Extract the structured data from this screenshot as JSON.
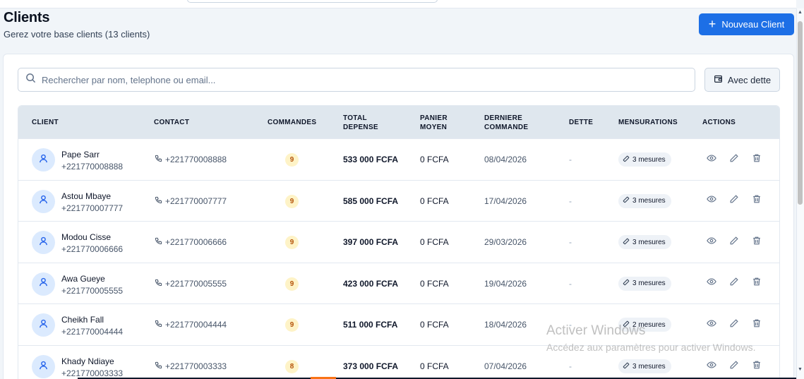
{
  "header": {
    "title": "Clients",
    "subtitle": "Gerez votre base clients (13 clients)",
    "new_client_label": "Nouveau Client"
  },
  "search": {
    "placeholder": "Rechercher par nom, telephone ou email..."
  },
  "filter": {
    "debt_label": "Avec dette"
  },
  "table": {
    "headers": {
      "client": "CLIENT",
      "contact": "CONTACT",
      "commandes": "COMMANDES",
      "total_1": "TOTAL",
      "total_2": "DEPENSE",
      "panier_1": "PANIER",
      "panier_2": "MOYEN",
      "derniere_1": "DERNIERE",
      "derniere_2": "COMMANDE",
      "dette": "DETTE",
      "mensurations": "MENSURATIONS",
      "actions": "ACTIONS"
    },
    "rows": [
      {
        "name": "Pape Sarr",
        "phone": "+221770008888",
        "contact": "+221770008888",
        "orders": "9",
        "total": "533 000 FCFA",
        "panier": "0 FCFA",
        "date": "08/04/2026",
        "dette": "-",
        "mesures": "3 mesures"
      },
      {
        "name": "Astou Mbaye",
        "phone": "+221770007777",
        "contact": "+221770007777",
        "orders": "9",
        "total": "585 000 FCFA",
        "panier": "0 FCFA",
        "date": "17/04/2026",
        "dette": "-",
        "mesures": "3 mesures"
      },
      {
        "name": "Modou Cisse",
        "phone": "+221770006666",
        "contact": "+221770006666",
        "orders": "9",
        "total": "397 000 FCFA",
        "panier": "0 FCFA",
        "date": "29/03/2026",
        "dette": "-",
        "mesures": "3 mesures"
      },
      {
        "name": "Awa Gueye",
        "phone": "+221770005555",
        "contact": "+221770005555",
        "orders": "9",
        "total": "423 000 FCFA",
        "panier": "0 FCFA",
        "date": "19/04/2026",
        "dette": "-",
        "mesures": "3 mesures"
      },
      {
        "name": "Cheikh Fall",
        "phone": "+221770004444",
        "contact": "+221770004444",
        "orders": "9",
        "total": "511 000 FCFA",
        "panier": "0 FCFA",
        "date": "18/04/2026",
        "dette": "-",
        "mesures": "2 mesures"
      },
      {
        "name": "Khady Ndiaye",
        "phone": "+221770003333",
        "contact": "+221770003333",
        "orders": "8",
        "total": "373 000 FCFA",
        "panier": "0 FCFA",
        "date": "07/04/2026",
        "dette": "-",
        "mesures": "3 mesures"
      }
    ]
  },
  "watermark": {
    "line1": "Activer Windows",
    "line2": "Accédez aux paramètres pour activer Windows."
  },
  "icons": {
    "search": "search-icon",
    "plus": "plus-icon",
    "wallet": "wallet-icon",
    "user": "user-icon",
    "phone": "phone-icon",
    "ruler": "ruler-icon",
    "eye": "eye-icon",
    "pencil": "pencil-icon",
    "trash": "trash-icon"
  },
  "colors": {
    "primary": "#1d6fe6",
    "header_bg": "#dfe7ee",
    "avatar_bg": "#dbeafe",
    "orders_badge_bg": "#fef3c7",
    "orders_badge_text": "#b45309"
  }
}
